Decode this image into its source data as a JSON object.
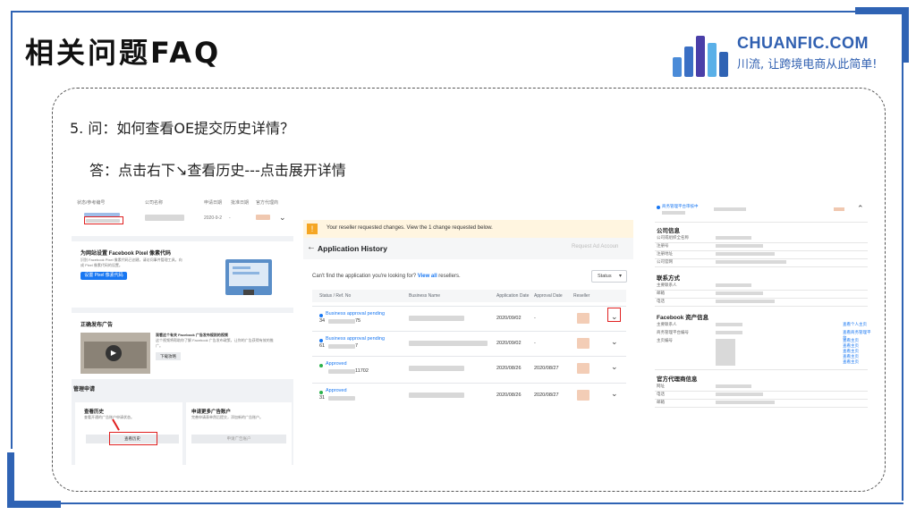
{
  "header": {
    "title": "相关问题FAQ",
    "logo_name": "CHUANFIC.COM",
    "logo_slogan": "川流, 让跨境电商从此简单!"
  },
  "content": {
    "question": "5. 问：如何查看OE提交历史详情？",
    "answer": "答：点击右下↘查看历史---点击展开详情"
  },
  "shot1": {
    "table_headers": [
      "状态/参考编号",
      "公司名称",
      "申请日期",
      "批准日期",
      "官方代理商"
    ],
    "row_date": "2020-9-2",
    "row_dash": "-",
    "pixel_title": "为网站设置 Facebook Pixel 像素代码",
    "pixel_desc1": "识别 Facebook Pixel 像素代码已创建，请访问事件管理工具，向",
    "pixel_desc2": "成 Pixel 像素代码的设置。",
    "pixel_btn": "设置 Pixel 像素代码",
    "ads_title": "正确发布广告",
    "ads_desc1": "观看这个有关 Facebook 广告发布规则的视频",
    "ads_desc2": "这个视频将帮助你了解 Facebook 广告发布政策，让你的广告获得有效的推",
    "ads_desc3": "广。",
    "ads_btn": "下载攻略",
    "manage_title": "管理申请",
    "history_title": "查看历史",
    "history_desc": "查看开通的广告账户申请状态。",
    "history_btn": "查看历史",
    "more_title": "申请更多广告账户",
    "more_desc": "完善申请表单然后提交，添加新的广告账户。",
    "more_btn": "申请广告账户"
  },
  "shot2": {
    "warning": "Your reseller requested changes. View the 1 change requested below.",
    "title": "Application History",
    "request_btn": "Request Ad Accoun",
    "find_text": "Can't find the application you're looking for?",
    "view_all": "View all",
    "resellers": "resellers.",
    "status_dropdown": "Status",
    "columns": [
      "Status / Ref. No",
      "Business Name",
      "Application Date",
      "Approval Date",
      "Reseller"
    ],
    "rows": [
      {
        "status": "Business approval pending",
        "ref": "34",
        "ref_end": "75",
        "app_date": "2020/09/02",
        "appr_date": "-",
        "status_color": "#1877f2",
        "dot_color": "#1877f2"
      },
      {
        "status": "Business approval pending",
        "ref": "61",
        "ref_end": "7",
        "app_date": "2020/09/02",
        "appr_date": "-",
        "status_color": "#1877f2",
        "dot_color": "#1877f2"
      },
      {
        "status": "Approved",
        "ref": "",
        "ref_end": "11702",
        "app_date": "2020/08/26",
        "appr_date": "2020/08/27",
        "status_color": "#1877f2",
        "dot_color": "#2bb24c"
      },
      {
        "status": "Approved",
        "ref": "31",
        "ref_end": "",
        "app_date": "2020/08/26",
        "appr_date": "2020/08/27",
        "status_color": "#1877f2",
        "dot_color": "#2bb24c"
      }
    ]
  },
  "shot3": {
    "top_link": "商务管理平台审核中",
    "sec_company": "公司信息",
    "company_labels": [
      "公司或组织全名称",
      "注册号",
      "注册地址",
      "公司官网"
    ],
    "sec_contact": "联系方式",
    "contact_labels": [
      "主要联系人",
      "邮箱",
      "电话"
    ],
    "sec_fb": "Facebook 资产信息",
    "fb_labels": [
      "主要联系人",
      "商务管理平台编号",
      "主页编号"
    ],
    "fb_links": [
      "查看个人主页",
      "查看商务管理平台",
      "查看主页",
      "查看主页",
      "查看主页",
      "查看主页",
      "查看主页"
    ],
    "sec_agent": "官方代理商信息",
    "agent_labels": [
      "网址",
      "电话",
      "邮箱"
    ]
  },
  "colors": {
    "accent": "#2f63b4",
    "fb_blue": "#1877f2",
    "highlight": "#e02020"
  }
}
